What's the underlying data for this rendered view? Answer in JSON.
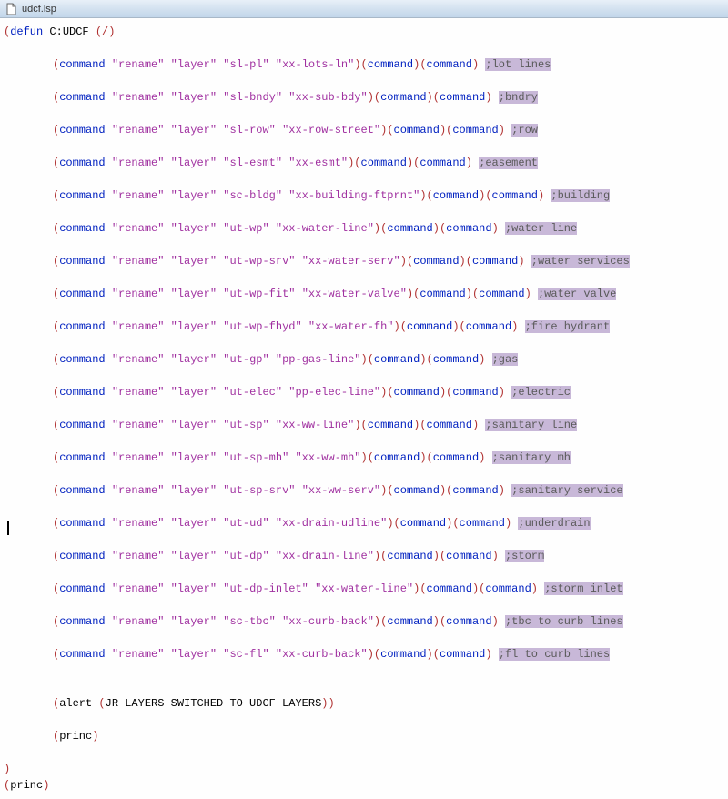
{
  "title": "udcf.lsp",
  "defun_line": {
    "keyword": "defun",
    "name": "C:UDCF",
    "args": "(/)"
  },
  "commands": [
    {
      "old": "sl-pl",
      "new": "xx-lots-ln",
      "comment": ";lot lines"
    },
    {
      "old": "sl-bndy",
      "new": "xx-sub-bdy",
      "comment": ";bndry"
    },
    {
      "old": "sl-row",
      "new": "xx-row-street",
      "comment": ";row"
    },
    {
      "old": "sl-esmt",
      "new": "xx-esmt",
      "comment": ";easement"
    },
    {
      "old": "sc-bldg",
      "new": "xx-building-ftprnt",
      "comment": ";building"
    },
    {
      "old": "ut-wp",
      "new": "xx-water-line",
      "comment": ";water line"
    },
    {
      "old": "ut-wp-srv",
      "new": "xx-water-serv",
      "comment": ";water services"
    },
    {
      "old": "ut-wp-fit",
      "new": "xx-water-valve",
      "comment": ";water valve"
    },
    {
      "old": "ut-wp-fhyd",
      "new": "xx-water-fh",
      "comment": ";fire hydrant"
    },
    {
      "old": "ut-gp",
      "new": "pp-gas-line",
      "comment": ";gas"
    },
    {
      "old": "ut-elec",
      "new": "pp-elec-line",
      "comment": ";electric"
    },
    {
      "old": "ut-sp",
      "new": "xx-ww-line",
      "comment": ";sanitary line"
    },
    {
      "old": "ut-sp-mh",
      "new": "xx-ww-mh",
      "comment": ";sanitary mh"
    },
    {
      "old": "ut-sp-srv",
      "new": "xx-ww-serv",
      "comment": ";sanitary service"
    },
    {
      "old": "ut-ud",
      "new": "xx-drain-udline",
      "comment": ";underdrain"
    },
    {
      "old": "ut-dp",
      "new": "xx-drain-line",
      "comment": ";storm"
    },
    {
      "old": "ut-dp-inlet",
      "new": "xx-water-line",
      "comment": ";storm inlet"
    },
    {
      "old": "sc-tbc",
      "new": "xx-curb-back",
      "comment": ";tbc to curb lines"
    },
    {
      "old": "sc-fl",
      "new": "xx-curb-back",
      "comment": ";fl to curb lines"
    }
  ],
  "cmd_keyword": "command",
  "rename_str": "\"rename\"",
  "layer_str": "\"layer\"",
  "alert_line": "(alert (JR LAYERS SWITCHED TO UDCF LAYERS))",
  "princ": "(princ)"
}
